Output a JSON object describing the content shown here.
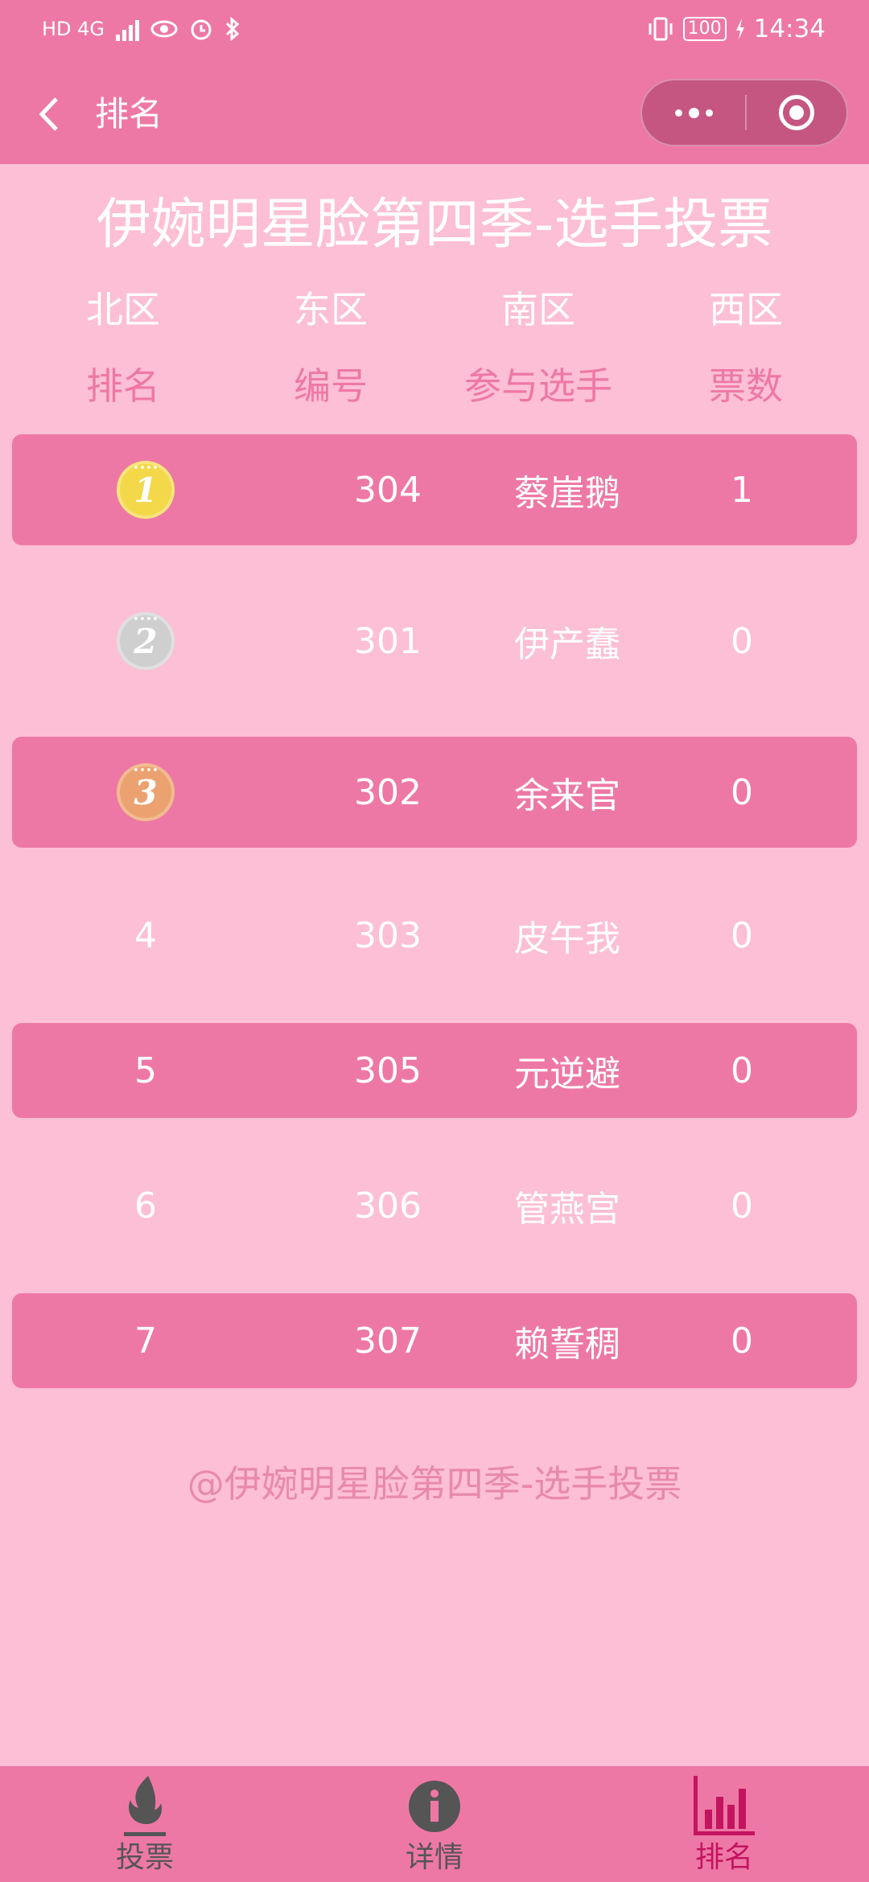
{
  "status_bar": {
    "left_text": "HD 4G",
    "time": "14:34",
    "battery": "100"
  },
  "nav": {
    "title": "排名"
  },
  "page": {
    "title": "伊婉明星脸第四季-选手投票"
  },
  "tabs": [
    {
      "label": "北区",
      "active": true
    },
    {
      "label": "东区",
      "active": false
    },
    {
      "label": "南区",
      "active": false
    },
    {
      "label": "西区",
      "active": false
    }
  ],
  "table": {
    "headers": [
      "排名",
      "编号",
      "参与选手",
      "票数"
    ],
    "rows": [
      {
        "rank": "1",
        "medal": "gold",
        "number": "304",
        "name": "蔡崖鹅",
        "votes": "1"
      },
      {
        "rank": "2",
        "medal": "silver",
        "number": "301",
        "name": "伊产蠢",
        "votes": "0"
      },
      {
        "rank": "3",
        "medal": "bronze",
        "number": "302",
        "name": "余来官",
        "votes": "0"
      },
      {
        "rank": "4",
        "medal": "",
        "number": "303",
        "name": "皮午我",
        "votes": "0"
      },
      {
        "rank": "5",
        "medal": "",
        "number": "305",
        "name": "元逆避",
        "votes": "0"
      },
      {
        "rank": "6",
        "medal": "",
        "number": "306",
        "name": "管燕宫",
        "votes": "0"
      },
      {
        "rank": "7",
        "medal": "",
        "number": "307",
        "name": "赖誓稠",
        "votes": "0"
      }
    ]
  },
  "footer_note": "@伊婉明星脸第四季-选手投票",
  "bottom_tabs": [
    {
      "label": "投票",
      "icon": "flame-icon",
      "active": false
    },
    {
      "label": "详情",
      "icon": "info-icon",
      "active": false
    },
    {
      "label": "排名",
      "icon": "bar-chart-icon",
      "active": true
    }
  ],
  "colors": {
    "primary": "#ee78a5",
    "background": "#fdbfd5",
    "accent": "#c4145f"
  }
}
